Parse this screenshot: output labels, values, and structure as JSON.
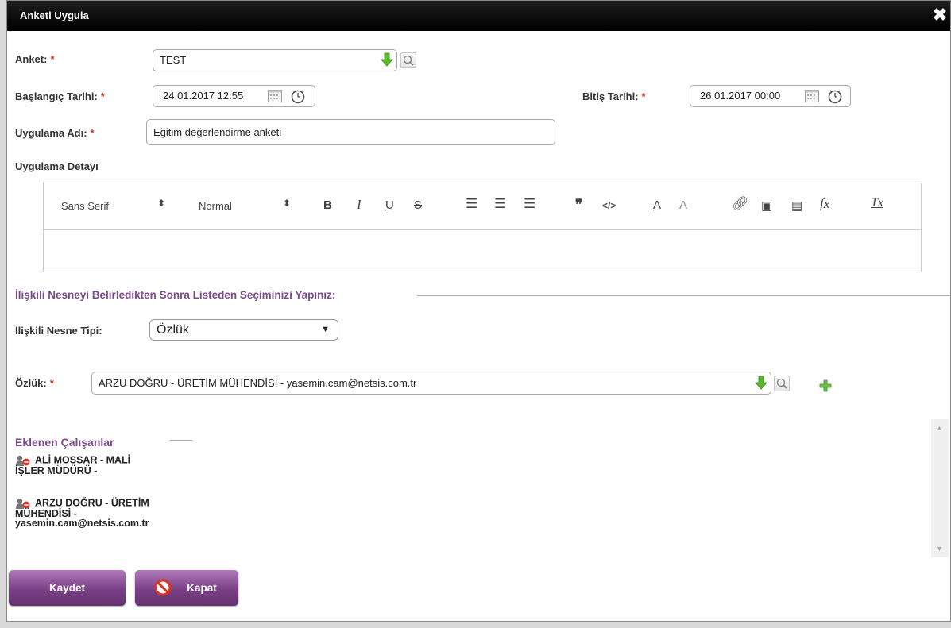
{
  "dialog": {
    "title": "Anketi Uygula"
  },
  "form": {
    "anket": {
      "label": "Anket:",
      "value": "TEST"
    },
    "baslangic": {
      "label": "Başlangıç Tarihi:",
      "value": "24.01.2017 12:55"
    },
    "bitis": {
      "label": "Bitiş Tarihi:",
      "value": "26.01.2017 00:00"
    },
    "uygulama_adi": {
      "label": "Uygulama Adı:",
      "value": "Eğitim değerlendirme anketi"
    },
    "uygulama_detayi": {
      "label": "Uygulama Detayı"
    },
    "required_mark": "*"
  },
  "editor": {
    "font": "Sans Serif",
    "size": "Normal",
    "tools": [
      "bold-icon",
      "italic-icon",
      "underline-icon",
      "strike-icon",
      "ordered-list-icon",
      "bullet-list-icon",
      "indent-icon",
      "blockquote-icon",
      "code-icon",
      "font-color-icon",
      "background-color-icon",
      "link-icon",
      "image-icon",
      "video-icon",
      "formula-icon",
      "clear-format-icon"
    ]
  },
  "related": {
    "section_title": "İlişkili Nesneyi Belirledikten Sonra Listeden Seçiminizi Yapınız:",
    "type_label": "İlişkili Nesne Tipi:",
    "type_value": "Özlük",
    "ozluk_label": "Özlük:",
    "ozluk_value": "ARZU DOĞRU - ÜRETİM MÜHENDİSİ - yasemin.cam@netsis.com.tr"
  },
  "employees": {
    "title": "Eklenen Çalışanlar",
    "items": [
      {
        "line1": "ALİ MOSSAR - MALİ",
        "line2": "İŞLER MÜDÜRÜ -",
        "line3": ""
      },
      {
        "line1": "ARZU DOĞRU - ÜRETİM",
        "line2": "MÜHENDİSİ -",
        "line3": "yasemin.cam@netsis.com.tr"
      }
    ]
  },
  "buttons": {
    "save": "Kaydet",
    "close": "Kapat"
  },
  "colors": {
    "accent": "#7b4a8a",
    "button": "#7a3f86",
    "required": "#c0392b",
    "titlebar": "#000000"
  }
}
